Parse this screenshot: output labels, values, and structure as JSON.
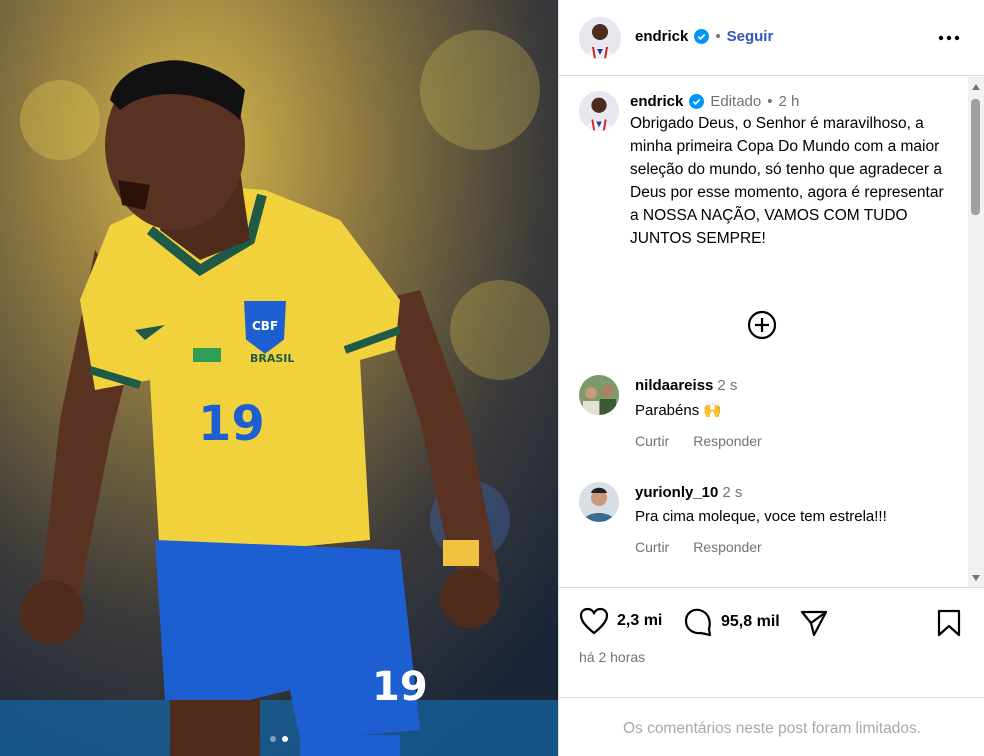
{
  "photo": {
    "alt": "Player celebrating in yellow Brazil jersey",
    "jersey_number": "19",
    "crest_text": "BRASIL",
    "carousel_count": 2,
    "carousel_active": 1
  },
  "header": {
    "username": "endrick",
    "separator": "•",
    "follow_label": "Seguir"
  },
  "post": {
    "username": "endrick",
    "edited_label": "Editado",
    "separator": "•",
    "time": "2 h",
    "caption": "Obrigado Deus, o Senhor é maravilhoso, a minha primeira Copa Do Mundo com a maior seleção do mundo, só tenho que agradecer a Deus por esse momento, agora é representar a NOSSA NAÇÃO, VAMOS COM TUDO JUNTOS SEMPRE!"
  },
  "comments": [
    {
      "username": "nildaareiss",
      "time": "2 s",
      "text": "Parabéns 🙌",
      "like_label": "Curtir",
      "reply_label": "Responder"
    },
    {
      "username": "yurionly_10",
      "time": "2 s",
      "text": "Pra cima moleque, voce tem estrela!!!",
      "like_label": "Curtir",
      "reply_label": "Responder"
    }
  ],
  "actions": {
    "likes": "2,3 mi",
    "comments": "95,8 mil",
    "time_ago": "há 2 horas"
  },
  "footer": {
    "limited_text": "Os comentários neste post foram limitados."
  },
  "colors": {
    "verified": "#0095f6",
    "follow": "#3456b8",
    "muted": "#737373",
    "jersey": "#f2d23c",
    "shorts": "#1d5fd1"
  }
}
